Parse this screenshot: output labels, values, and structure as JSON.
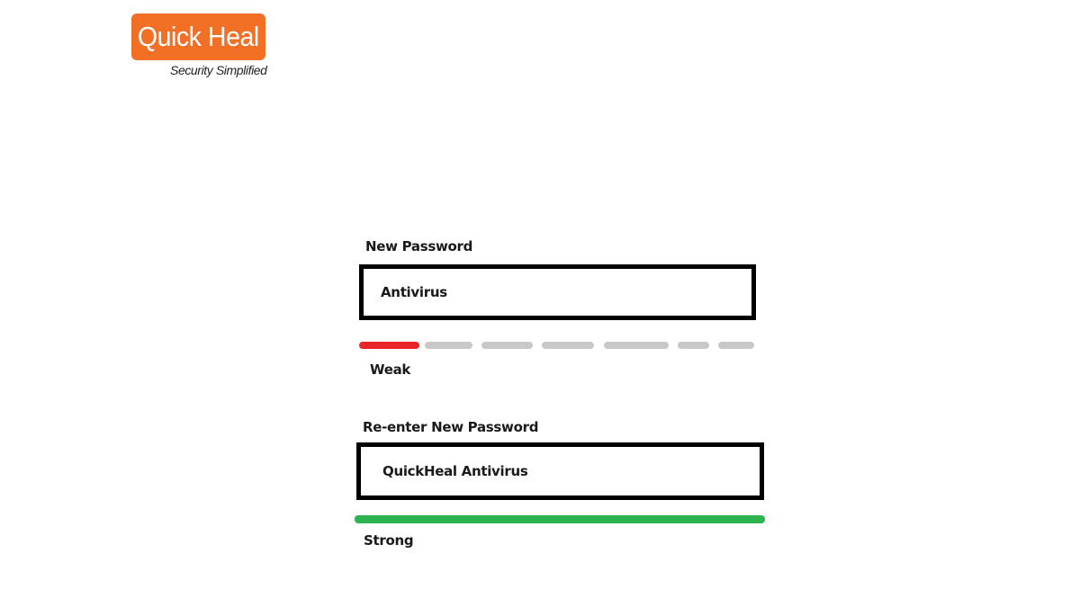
{
  "logo": {
    "name": "Quick Heal",
    "tagline": "Security Simplified",
    "color": "#f26f26"
  },
  "new_password": {
    "label": "New Password",
    "value": "Antivirus",
    "strength_label": "Weak",
    "strength_color": "#e8262a",
    "strength_level": 0.15
  },
  "reenter_password": {
    "label": "Re-enter New Password",
    "value": "QuickHeal Antivirus",
    "strength_label": "Strong",
    "strength_color": "#2db350",
    "strength_level": 1.0
  },
  "colors": {
    "inactive_segment": "#c8c8c8",
    "border": "#000000"
  }
}
